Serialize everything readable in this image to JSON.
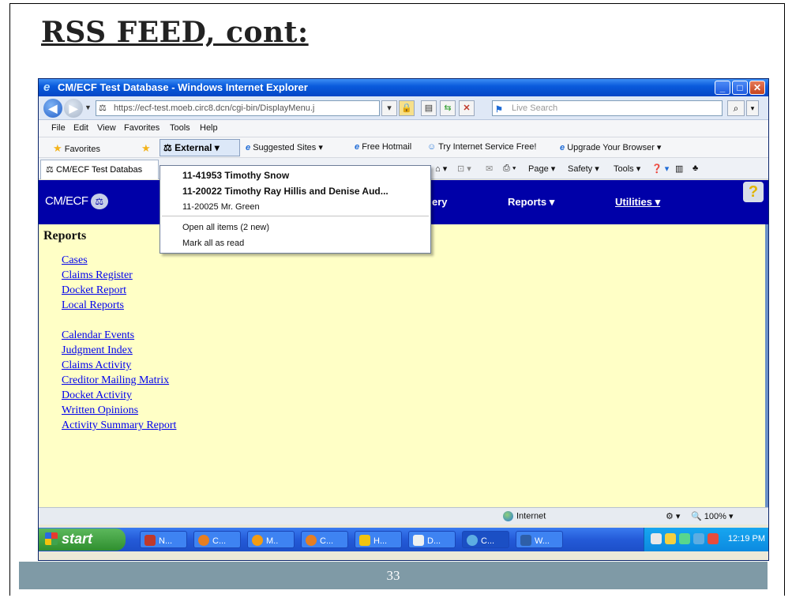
{
  "slide": {
    "title": "RSS FEED, cont:",
    "page_number": "33"
  },
  "window": {
    "title": "CM/ECF Test Database - Windows Internet Explorer",
    "minimize": "_",
    "maximize": "□",
    "close": "✕"
  },
  "address": {
    "url": "https://ecf-test.moeb.circ8.dcn/cgi-bin/DisplayMenu.j",
    "search_placeholder": "Live Search"
  },
  "menu": {
    "items": [
      "File",
      "Edit",
      "View",
      "Favorites",
      "Tools",
      "Help"
    ]
  },
  "favorites_bar": {
    "favorites_label": "Favorites",
    "external_label": "External",
    "suggested_sites": "Suggested Sites",
    "free_hotmail": "Free Hotmail",
    "try_internet": "Try Internet Service Free!",
    "upgrade_browser": "Upgrade Your Browser"
  },
  "command_bar": {
    "tab_label": "CM/ECF Test Databas",
    "page": "Page",
    "safety": "Safety",
    "tools": "Tools"
  },
  "rss_dropdown": {
    "items": [
      "11-41953 Timothy Snow",
      "11-20022 Timothy Ray Hillis and Denise Aud...",
      "11-20025 Mr. Green"
    ],
    "open_all": "Open all items (2 new)",
    "mark_all_read": "Mark all as read"
  },
  "cmecf": {
    "logo_text": "CM/ECF",
    "menu_partial": "ery",
    "reports": "Reports",
    "utilities": "Utilities",
    "help": "?"
  },
  "page": {
    "heading": "Reports",
    "links_group1": [
      "Cases",
      "Claims Register",
      "Docket Report",
      "Local Reports"
    ],
    "links_group2": [
      "Calendar Events",
      "Judgment Index",
      "Claims Activity",
      "Creditor Mailing Matrix",
      "Docket Activity",
      "Written Opinions",
      "Activity Summary Report"
    ]
  },
  "status": {
    "zone": "Internet",
    "zoom": "100%"
  },
  "taskbar": {
    "start": "start",
    "tasks": [
      "N...",
      "C...",
      "M..",
      "C...",
      "H...",
      "D...",
      "C...",
      "W..."
    ],
    "clock": "12:19 PM"
  },
  "colors": {
    "cmecf_header": "#0000a8",
    "page_background": "#ffffc6",
    "link": "#0000ee",
    "footer_band": "#7f9aa6"
  }
}
